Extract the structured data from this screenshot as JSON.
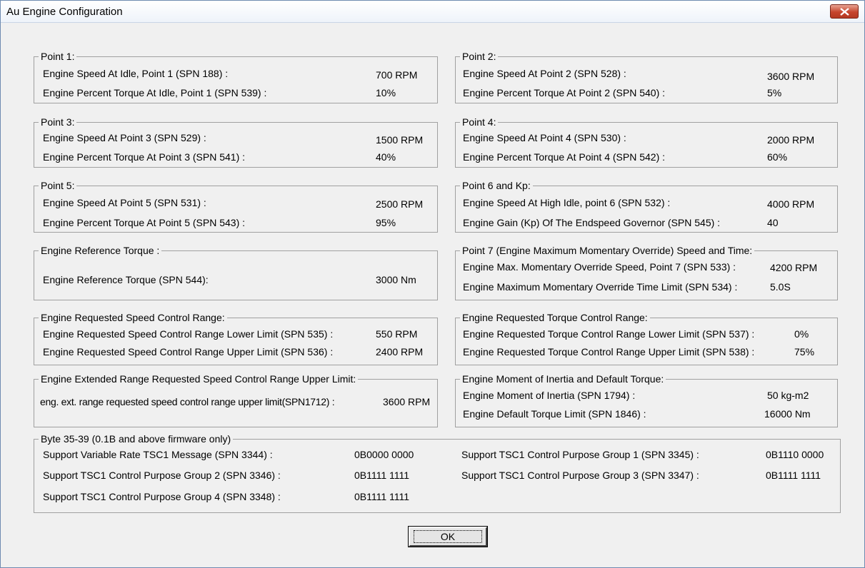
{
  "window": {
    "title": "Au Engine Configuration",
    "ok_label": "OK"
  },
  "groups": {
    "point1": {
      "title": "Point 1:",
      "rows": [
        {
          "label": "Engine Speed At Idle, Point 1 (SPN 188) :",
          "value": "700 RPM"
        },
        {
          "label": "Engine Percent Torque At Idle, Point 1 (SPN 539) :",
          "value": "10%"
        }
      ]
    },
    "point2": {
      "title": "Point 2:",
      "rows": [
        {
          "label": "Engine Speed At Point 2 (SPN 528) :",
          "value": "3600 RPM"
        },
        {
          "label": "Engine Percent Torque At Point 2 (SPN 540) :",
          "value": "5%"
        }
      ]
    },
    "point3": {
      "title": "Point 3:",
      "rows": [
        {
          "label": "Engine Speed At Point 3 (SPN 529) :",
          "value": "1500 RPM"
        },
        {
          "label": "Engine Percent Torque At Point 3 (SPN 541) :",
          "value": "40%"
        }
      ]
    },
    "point4": {
      "title": "Point 4:",
      "rows": [
        {
          "label": "Engine Speed At Point 4 (SPN 530) :",
          "value": "2000 RPM"
        },
        {
          "label": "Engine Percent Torque At Point 4 (SPN 542) :",
          "value": "60%"
        }
      ]
    },
    "point5": {
      "title": "Point 5:",
      "rows": [
        {
          "label": "Engine Speed At Point 5 (SPN 531) :",
          "value": "2500 RPM"
        },
        {
          "label": "Engine Percent Torque At Point 5 (SPN 543) :",
          "value": "95%"
        }
      ]
    },
    "point6": {
      "title": "Point 6 and Kp:",
      "rows": [
        {
          "label": "Engine Speed At High Idle, point 6 (SPN 532) :",
          "value": "4000 RPM"
        },
        {
          "label": "Engine Gain (Kp) Of The Endspeed Governor (SPN 545) :",
          "value": "40"
        }
      ]
    },
    "ref_torque": {
      "title": "Engine Reference Torque :",
      "rows": [
        {
          "label": "Engine Reference Torque (SPN 544):",
          "value": "3000 Nm"
        }
      ]
    },
    "point7": {
      "title": "Point 7 (Engine Maximum Momentary Override) Speed and Time:",
      "rows": [
        {
          "label": "Engine Max. Momentary Override Speed, Point 7 (SPN 533) :",
          "value": "4200 RPM"
        },
        {
          "label": "Engine Maximum Momentary Override Time Limit (SPN 534) :",
          "value": "5.0S"
        }
      ]
    },
    "speed_range": {
      "title": "Engine Requested Speed Control Range:",
      "rows": [
        {
          "label": "Engine Requested Speed Control Range Lower Limit (SPN 535) :",
          "value": "550 RPM"
        },
        {
          "label": "Engine Requested Speed Control Range Upper Limit  (SPN 536) :",
          "value": "2400 RPM"
        }
      ]
    },
    "torque_range": {
      "title": "Engine Requested Torque Control Range:",
      "rows": [
        {
          "label": "Engine Requested Torque Control Range Lower Limit (SPN 537) :",
          "value": "0%"
        },
        {
          "label": "Engine Requested Torque Control Range Upper Limit (SPN 538) :",
          "value": "75%"
        }
      ]
    },
    "ext_range": {
      "title": "Engine Extended Range Requested Speed Control Range Upper Limit:",
      "rows": [
        {
          "label": "eng. ext. range requested speed control range upper limit(SPN1712) :",
          "value": "3600 RPM"
        }
      ]
    },
    "inertia": {
      "title": "Engine Moment of Inertia and Default Torque:",
      "rows": [
        {
          "label": "Engine Moment of Inertia (SPN 1794) :",
          "value": "50 kg-m2"
        },
        {
          "label": "Engine Default Torque Limit (SPN 1846) :",
          "value": "16000 Nm"
        }
      ]
    },
    "bytes": {
      "title": "Byte 35-39 (0.1B and above firmware only)",
      "rows": [
        {
          "label": "Support Variable Rate TSC1 Message  (SPN 3344) :",
          "value": "0B0000 0000"
        },
        {
          "label": "Support TSC1 Control Purpose Group 1 (SPN 3345) :",
          "value": "0B1110 0000"
        },
        {
          "label": "Support TSC1 Control Purpose Group 2 (SPN 3346) :",
          "value": "0B1111 1111"
        },
        {
          "label": "Support TSC1 Control Purpose Group 3 (SPN 3347) :",
          "value": "0B1111 1111"
        },
        {
          "label": "Support TSC1 Control Purpose Group 4 (SPN 3348) :",
          "value": "0B1111 1111"
        }
      ]
    }
  }
}
